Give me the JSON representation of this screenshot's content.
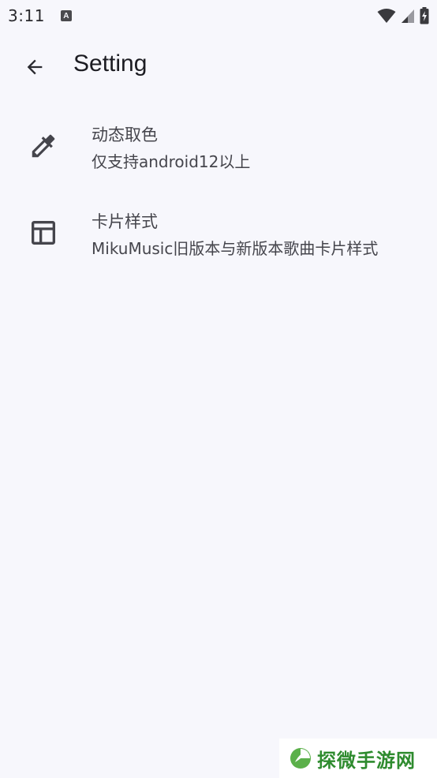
{
  "status_bar": {
    "time": "3:11",
    "notification_letter": "A",
    "icons": [
      "wifi-icon",
      "cellular-signal-icon",
      "battery-charging-icon"
    ]
  },
  "app_bar": {
    "back_icon": "arrow-back-icon",
    "title": "Setting"
  },
  "settings": [
    {
      "icon": "color-picker-icon",
      "title": "动态取色",
      "summary": "仅支持android12以上"
    },
    {
      "icon": "card-layout-icon",
      "title": "卡片样式",
      "summary": "MikuMusic旧版本与新版本歌曲卡片样式"
    }
  ],
  "watermark": {
    "text": "探微手游网"
  },
  "colors": {
    "background": "#f7f7fc",
    "text_primary": "#1c1c22",
    "text_secondary": "#45454c",
    "watermark_green": "#2e8b2e"
  }
}
